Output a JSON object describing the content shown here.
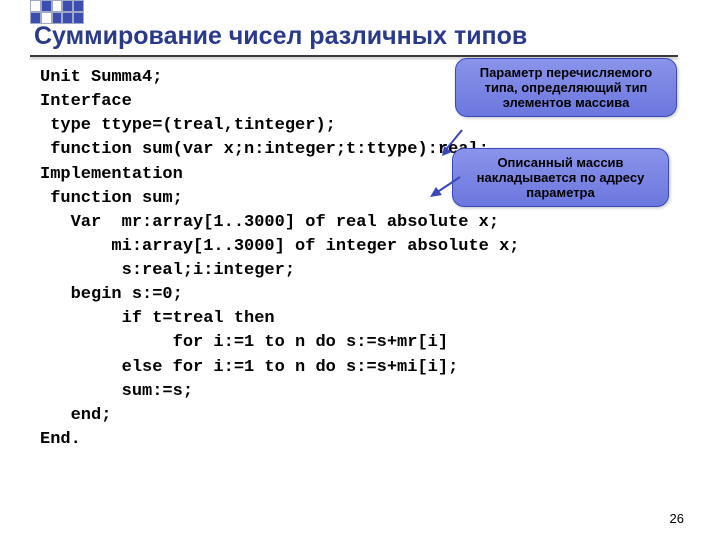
{
  "title": "Суммирование чисел различных типов",
  "code": [
    "Unit Summa4;",
    "Interface",
    " type ttype=(treal,tinteger);",
    " function sum(var x;n:integer;t:ttype):real;",
    "Implementation",
    " function sum;",
    "   Var  mr:array[1..3000] of real absolute x;",
    "       mi:array[1..3000] of integer absolute x;",
    "        s:real;i:integer;",
    "   begin s:=0;",
    "        if t=treal then",
    "             for i:=1 to n do s:=s+mr[i]",
    "        else for i:=1 to n do s:=s+mi[i];",
    "        sum:=s;",
    "   end;",
    "End."
  ],
  "callout1": "Параметр перечисляемого типа, определяющий тип элементов массива",
  "callout2": "Описанный массив накладывается по адресу параметра",
  "pagenum": "26"
}
